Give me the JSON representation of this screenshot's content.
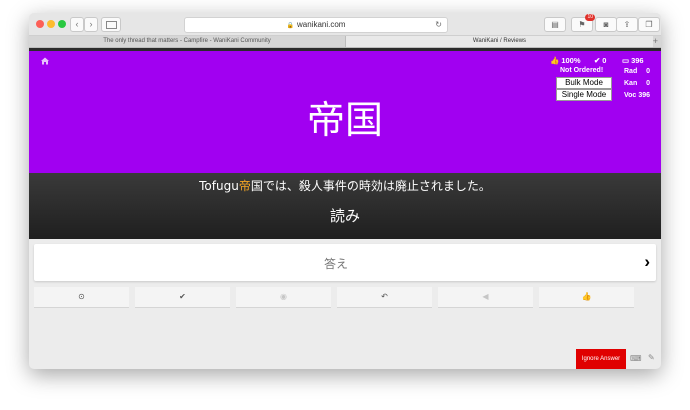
{
  "browser": {
    "address": "wanikani.com",
    "notification_count": "10",
    "tabs": [
      {
        "label": "The only thread that matters - Campfire - WaniKani Community"
      },
      {
        "label": "WaniKani / Reviews"
      }
    ]
  },
  "stats": {
    "percent": "100%",
    "correct": "0",
    "remaining": "396",
    "ordering": "Not Ordered!",
    "bulk_mode": "Bulk Mode",
    "single_mode": "Single Mode",
    "rad_label": "Rad",
    "rad_count": "0",
    "kan_label": "Kan",
    "kan_count": "0",
    "voc_label": "Voc",
    "voc_count": "396"
  },
  "review": {
    "character": "帝国",
    "sentence_pre": "Tofugu",
    "sentence_hl": "帝",
    "sentence_post": "国では、殺人事件の時効は廃止されました。",
    "question_type": "読み",
    "answer_placeholder": "答え"
  },
  "actions": [
    {
      "icon": "clock-icon",
      "glyph": "⊙"
    },
    {
      "icon": "check-icon",
      "glyph": "✔"
    },
    {
      "icon": "eye-icon",
      "glyph": "◉"
    },
    {
      "icon": "undo-icon",
      "glyph": "↶"
    },
    {
      "icon": "audio-icon",
      "glyph": "◀"
    },
    {
      "icon": "thumbs-up-icon",
      "glyph": "👍"
    }
  ],
  "footer": {
    "ignore_answer": "Ignore Answer"
  },
  "colors": {
    "header": "#a100f1",
    "highlight": "#f5a623",
    "ignore": "#e00000"
  }
}
